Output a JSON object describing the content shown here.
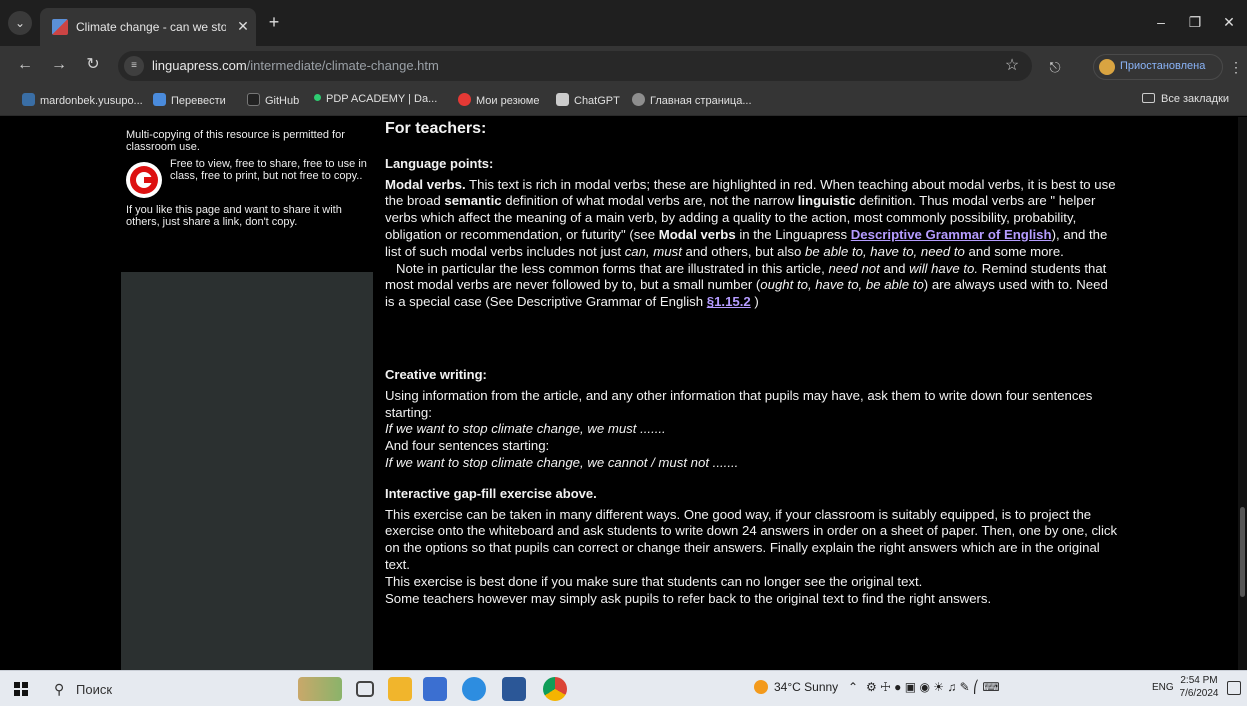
{
  "browser": {
    "tab_title": "Climate change - can we stop it",
    "url_host": "linguapress.com",
    "url_path": "/intermediate/climate-change.htm",
    "profile_label": "Приостановлена",
    "bookmarks": [
      {
        "label": "mardonbek.yusupo...",
        "color": "#3a6ea5"
      },
      {
        "label": "Перевести",
        "color": "#4a8bdc"
      },
      {
        "label": "GitHub",
        "color": "#222222"
      },
      {
        "label": "PDP ACADEMY | Da...",
        "color": "#2ecc71"
      },
      {
        "label": "Мои резюме",
        "color": "#e53935"
      },
      {
        "label": "ChatGPT",
        "color": "#cccccc"
      },
      {
        "label": "Главная страница...",
        "color": "#8e8e8e"
      }
    ],
    "all_bookmarks": "Все закладки"
  },
  "sidebar": {
    "notice_top": "Multi-copying of this resource is permitted for classroom use.",
    "notice_free": "Free to view, free to share, free to use in class, free to print, but not free to copy..",
    "notice_share": "If you like this page and want to share it with others, just share a link, don't copy."
  },
  "content": {
    "heading": "For teachers:",
    "lang_points_title": "Language points:",
    "modal_lead": "Modal verbs.",
    "modal_text_1": " This text is rich in modal verbs; these are highlighted in red. When teaching about modal verbs, it is best to use the broad ",
    "semantic": "semantic",
    "modal_text_2": " definition of what modal verbs are, not the narrow ",
    "linguistic": "linguistic",
    "modal_text_3": " definition. Thus modal verbs are \" helper verbs which affect the meaning of a main verb, by adding a quality to the action, most commonly possibility, probability, obligation or recommendation, or futurity\"  (see ",
    "modal_verbs_bold": "Modal verbs",
    "modal_text_4": " in the Linguapress ",
    "grammar_link": "Descriptive Grammar of English",
    "modal_text_5": "), and the list of such modal verbs includes not just ",
    "can_must": "can, must",
    "modal_text_6": " and others, but also ",
    "be_able": "be able to, have to, need to",
    "modal_text_7": " and some more.",
    "note_text_1": "   Note in particular the less common forms that are illustrated in this article, ",
    "need_not": "need not",
    "note_and": " and ",
    "will_have_to": "will have to.",
    "note_text_2": " Remind students that most modal verbs are never followed by to, but a small number (",
    "ought": "ought to, have to, be able to",
    "note_text_3": ") are always used with to. Need is a special case (See Descriptive Grammar of English ",
    "section_link": "§1.15.2",
    "note_text_4": " )",
    "creative_title": "Creative writing:",
    "creative_text": " Using information from the article, and any other information that pupils may have, ask them to write down four sentences starting:",
    "creative_ex1": "If we want to stop climate change, we must .......",
    "creative_and": "And four sentences starting:",
    "creative_ex2": "If we want to stop climate change, we cannot / must not .......",
    "gapfill_title": "Interactive gap-fill exercise above.",
    "gapfill_text_1": "This exercise can be taken in many different ways. One good way, if your classroom is suitably equipped, is to project the exercise onto the whiteboard and ask students to write down 24 answers in order on a sheet of paper. Then, one by one, click on the options so that pupils can correct or change their answers. Finally explain the right answers which are in the original text.",
    "gapfill_text_2": "This exercise is best done if you make sure that students can no longer see the original text.",
    "gapfill_text_3": "Some teachers however may simply ask pupils to refer back to the original text to find the right answers."
  },
  "taskbar": {
    "search_placeholder": "Поиск",
    "weather": "34°C  Sunny",
    "lang": "ENG",
    "time": "2:54 PM",
    "date": "7/6/2024"
  }
}
